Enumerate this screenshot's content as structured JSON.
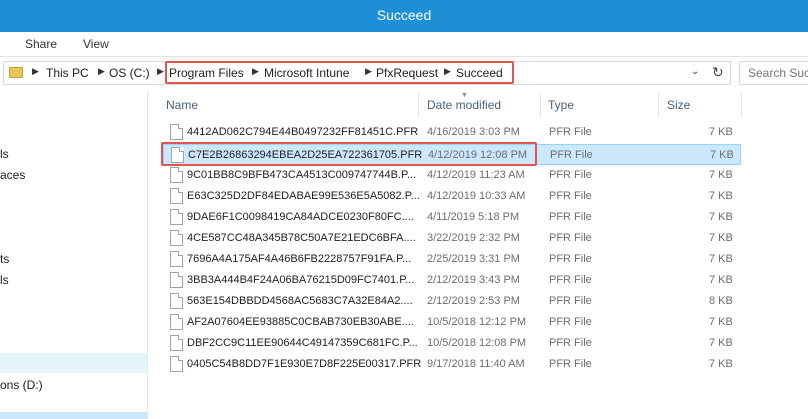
{
  "window": {
    "title": "Succeed"
  },
  "ribbon": {
    "tabs": [
      "Share",
      "View"
    ]
  },
  "address": {
    "crumbs": [
      "This PC",
      "OS (C:)",
      "Program Files",
      "Microsoft Intune",
      "PfxRequest",
      "Succeed"
    ]
  },
  "search": {
    "placeholder": "Search Succ"
  },
  "nav": {
    "items": [
      "ls",
      "aces",
      "ts",
      "ls",
      "ons (D:)"
    ]
  },
  "columns": {
    "name": "Name",
    "date": "Date modified",
    "type": "Type",
    "size": "Size"
  },
  "files": [
    {
      "name": "4412AD062C794E44B0497232FF81451C.PFR",
      "date": "4/16/2019 3:03 PM",
      "type": "PFR File",
      "size": "7 KB"
    },
    {
      "name": "C7E2B26863294EBEA2D25EA722361705.PFR",
      "date": "4/12/2019 12:08 PM",
      "type": "PFR File",
      "size": "7 KB"
    },
    {
      "name": "9C01BB8C9BFB473CA4513C009747744B.P...",
      "date": "4/12/2019 11:23 AM",
      "type": "PFR File",
      "size": "7 KB"
    },
    {
      "name": "E63C325D2DF84EDABAE99E536E5A5082.P...",
      "date": "4/12/2019 10:33 AM",
      "type": "PFR File",
      "size": "7 KB"
    },
    {
      "name": "9DAE6F1C0098419CA84ADCE0230F80FC....",
      "date": "4/11/2019 5:18 PM",
      "type": "PFR File",
      "size": "7 KB"
    },
    {
      "name": "4CE587CC48A345B78C50A7E21EDC6BFA....",
      "date": "3/22/2019 2:32 PM",
      "type": "PFR File",
      "size": "7 KB"
    },
    {
      "name": "7696A4A175AF4A46B6FB2228757F91FA.P...",
      "date": "2/25/2019 3:31 PM",
      "type": "PFR File",
      "size": "7 KB"
    },
    {
      "name": "3BB3A444B4F24A06BA76215D09FC7401.P...",
      "date": "2/12/2019 3:43 PM",
      "type": "PFR File",
      "size": "7 KB"
    },
    {
      "name": "563E154DBBDD4568AC5683C7A32E84A2....",
      "date": "2/12/2019 2:53 PM",
      "type": "PFR File",
      "size": "8 KB"
    },
    {
      "name": "AF2A07604EE93885C0CBAB730EB30ABE....",
      "date": "10/5/2018 12:12 PM",
      "type": "PFR File",
      "size": "7 KB"
    },
    {
      "name": "DBF2CC9C11EE90644C49147359C681FC.P...",
      "date": "10/5/2018 12:08 PM",
      "type": "PFR File",
      "size": "7 KB"
    },
    {
      "name": "0405C54B8DD7F1E930E7D8F225E00317.PFR",
      "date": "9/17/2018 11:40 AM",
      "type": "PFR File",
      "size": "7 KB"
    }
  ],
  "colors": {
    "titlebar": "#1d8fd8",
    "selection": "#cce8ff",
    "highlight": "#e05550"
  }
}
